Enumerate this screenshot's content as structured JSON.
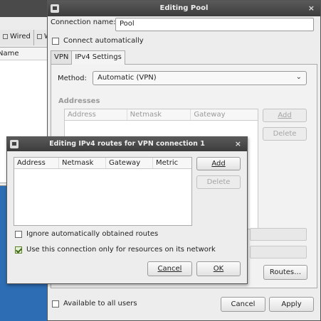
{
  "background_window": {
    "tabs": [
      {
        "label": "Wired"
      },
      {
        "label": "W"
      }
    ],
    "list_header": "Name"
  },
  "dialog": {
    "title": "Editing Pool",
    "close_glyph": "×",
    "connection_name_label": "Connection name:",
    "connection_name_value": "Pool",
    "connect_automatically": {
      "label": "Connect automatically",
      "checked": false
    },
    "tabs": [
      {
        "label": "VPN",
        "active": false
      },
      {
        "label": "IPv4 Settings",
        "active": true
      }
    ],
    "method_label": "Method:",
    "method_value": "Automatic (VPN)",
    "addresses_label": "Addresses",
    "addresses_columns": [
      "Address",
      "Netmask",
      "Gateway"
    ],
    "add_label": "Add",
    "delete_label": "Delete",
    "routes_label": "Routes…",
    "available_to_all_users": {
      "label": "Available to all users",
      "checked": false
    },
    "cancel_label": "Cancel",
    "apply_label": "Apply"
  },
  "routes_dialog": {
    "title": "Editing IPv4 routes for VPN connection 1",
    "columns": [
      "Address",
      "Netmask",
      "Gateway",
      "Metric"
    ],
    "rows": [],
    "add_label": "Add",
    "delete_label": "Delete",
    "ignore_routes": {
      "label": "Ignore automatically obtained routes",
      "checked": false
    },
    "only_resources": {
      "label": "Use this connection only for resources on its network",
      "checked": true
    },
    "cancel_label": "Cancel",
    "ok_label": "OK"
  },
  "icons": {
    "window_icon": "network-icon",
    "close": "close-icon",
    "dropdown": "chevron-down-icon"
  },
  "colors": {
    "desktop": "#2d6db3",
    "titlebar": "#4a4a4a",
    "dialog_bg": "#ededed"
  }
}
